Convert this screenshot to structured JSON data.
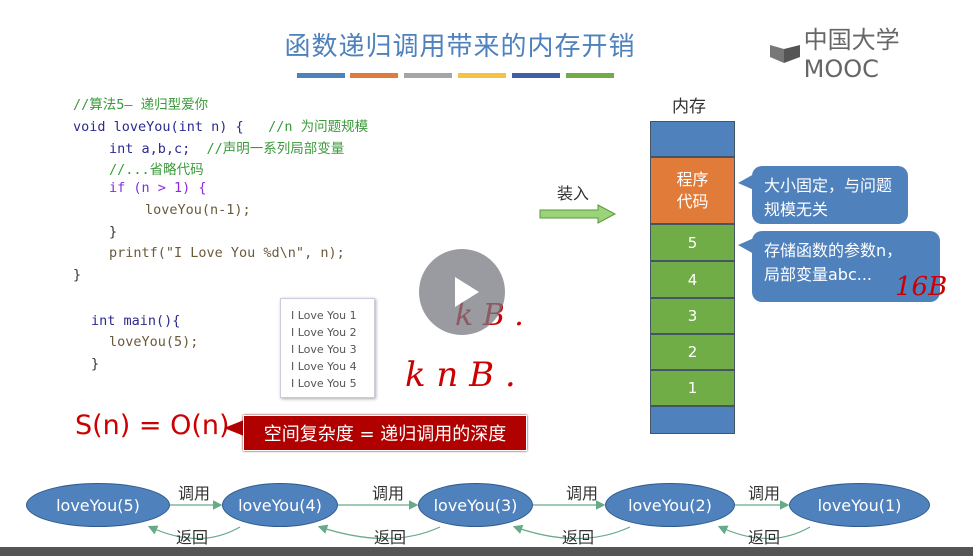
{
  "title": "函数递归调用带来的内存开销",
  "logo": "中国大学MOOC",
  "colors": {
    "bars": [
      "#4f81bd",
      "#e07b39",
      "#a5a5a5",
      "#f5c242",
      "#3f5fa8",
      "#70ad47"
    ],
    "title": "#4f81bd"
  },
  "code": {
    "l1": "//算法5— 递归型爱你",
    "l2a": "void loveYou(int n) {",
    "l2b": "//n 为问题规模",
    "l3a": "int a,b,c;",
    "l3b": "//声明一系列局部变量",
    "l4": "//...省略代码",
    "l5": "if (n > 1) {",
    "l6": "loveYou(n-1);",
    "l7": "}",
    "l8": "printf(\"I Love You %d\\n\", n);",
    "l9": "}",
    "m1": "int main(){",
    "m2": "loveYou(5);",
    "m3": "}"
  },
  "output": [
    "I Love You 1",
    "I Love You 2",
    "I Love You 3",
    "I Love You 4",
    "I Love You 5"
  ],
  "memory": {
    "label": "内存",
    "program": "程序代码",
    "frames": [
      "5",
      "4",
      "3",
      "2",
      "1"
    ],
    "load": "装入"
  },
  "callouts": {
    "c1": "大小固定，与问题规模无关",
    "c2a": "存储函数的参数n，",
    "c2b": "局部变量abc..."
  },
  "annotations": {
    "kb": "k B .",
    "knb": "k n B .",
    "b16": "16B"
  },
  "complexity": {
    "formula": "S(n) = O(n)",
    "note": "空间复杂度 = 递归调用的深度"
  },
  "chain": {
    "nodes": [
      "loveYou(5)",
      "loveYou(4)",
      "loveYou(3)",
      "loveYou(2)",
      "loveYou(1)"
    ],
    "call": "调用",
    "ret": "返回"
  }
}
